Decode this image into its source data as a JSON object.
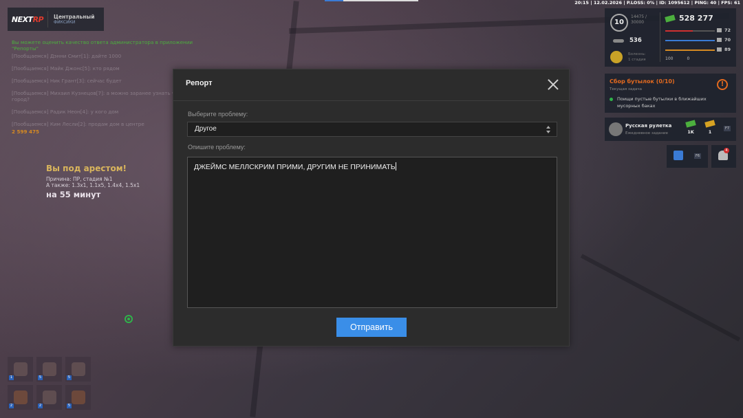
{
  "status_bar": {
    "text": "20:15 | 12.02.2026 | P.LOSS: 0% | ID: 1095612 | PING: 40 | FPS: 61"
  },
  "logo": {
    "brand_main": "NEXT",
    "brand_accent": "RP",
    "server_name": "Центральный",
    "server_sub": "ФИКСИКИ"
  },
  "chat": {
    "lines": [
      {
        "text": "Вы можете оценить качество ответа администратора в приложении \"Репорты\"",
        "style": "green"
      },
      {
        "text": "[Пообщаемся] Дэнни Смит[1]: дайте 1000",
        "style": "faded"
      },
      {
        "text": "[Пообщаемся] Майк Джонс[5]: кто рядом",
        "style": "faded"
      },
      {
        "text": "[Пообщаемся] Ник Грант[3]: сейчас будет",
        "style": "faded"
      },
      {
        "text": "[Пообщаемся] Михаил Кузнецов[7]: а можно заранее узнать что за город?",
        "style": "faded"
      },
      {
        "text": "[Пообщаемся] Радик Неон[4]: у кого дом",
        "style": "faded"
      },
      {
        "text": "[Пообщаемся] Ким Лесли[2]: продам дом в центре",
        "style": "faded"
      },
      {
        "text": "2 599 475",
        "style": "orange"
      }
    ]
  },
  "arrest": {
    "title": "Вы под арестом!",
    "reason": "Причина: ПР, стадия №1",
    "also": "А также: 1.3x1, 1.1x5, 1.4x4, 1.5x1",
    "duration": "на 55 минут"
  },
  "hud": {
    "level": "10",
    "xp_current": "14475 /",
    "xp_total": "30000",
    "money": "528 277",
    "cars": "536",
    "illness_title": "Болезнь:",
    "illness_stage": "1 стадия",
    "stats": [
      {
        "name": "health",
        "value": "72",
        "percent": 55,
        "color": "#d03030"
      },
      {
        "name": "hunger",
        "value": "70",
        "percent": 100,
        "color": "#3a7bd5"
      },
      {
        "name": "stamina",
        "value": "89",
        "percent": 100,
        "color": "#d68a22"
      }
    ],
    "armor": "100",
    "shield": "0"
  },
  "task": {
    "title": "Сбор бутылок (0/10)",
    "subtitle": "Текущая задача",
    "description": "Поищи пустые бутылки в ближайших мусорных баках",
    "icon": "!"
  },
  "roulette": {
    "title": "Русская рулетка",
    "subtitle": "Ежедневное задание",
    "prize1": "1K",
    "prize2": "1",
    "fkey": "F7"
  },
  "buttons": {
    "calendar_key": "F6",
    "notifications_count": "4"
  },
  "modal": {
    "title": "Репорт",
    "problem_label": "Выберите проблему:",
    "problem_value": "Другое",
    "describe_label": "Опишите проблему:",
    "message": "ДЖЕЙМС МЕЛЛСКРИМ ПРИМИ, ДРУГИМ НЕ ПРИНИМАТЬ",
    "send_label": "Отправить"
  },
  "inventory": [
    "1",
    "5",
    "5",
    "2",
    "2",
    "5"
  ],
  "colors": {
    "accent_blue": "#3a8ee8",
    "task_orange": "#e36a1f",
    "marker_green": "#2fb34a"
  }
}
